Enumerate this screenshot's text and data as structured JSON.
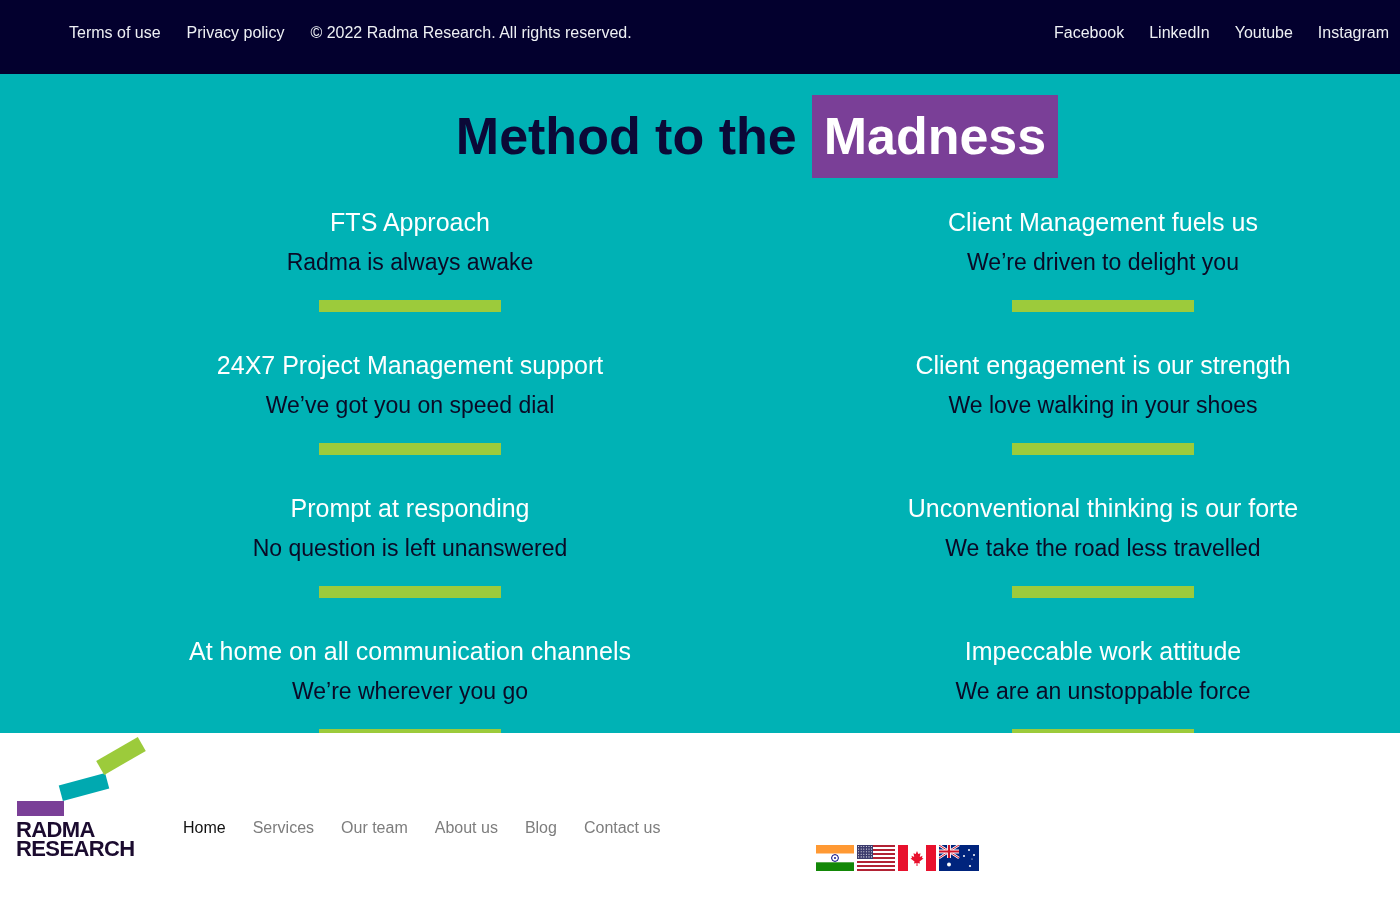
{
  "top_bar": {
    "legal_links": [
      "Terms of use",
      "Privacy policy"
    ],
    "copyright": "© 2022 Radma Research. All rights reserved.",
    "social_links": [
      "Facebook",
      "LinkedIn",
      "Youtube",
      "Instagram"
    ]
  },
  "method_section": {
    "title": "Method to the",
    "title_highlight": "Madness",
    "features": [
      {
        "heading": "FTS Approach",
        "tagline": "Radma is always awake"
      },
      {
        "heading": "Client Management fuels us",
        "tagline": "We’re driven to delight you"
      },
      {
        "heading": "24X7 Project Management support",
        "tagline": "We’ve got you on speed dial"
      },
      {
        "heading": "Client engagement is our strength",
        "tagline": "We love walking in your shoes"
      },
      {
        "heading": "Prompt at responding",
        "tagline": "No question is left unanswered"
      },
      {
        "heading": "Unconventional thinking is our forte",
        "tagline": "We take the road less travelled"
      },
      {
        "heading": "At home on all communication channels",
        "tagline": "We’re wherever you go"
      },
      {
        "heading": "Impeccable work attitude",
        "tagline": "We are an unstoppable force"
      }
    ]
  },
  "footer": {
    "logo_text": "RADMA RESEARCH",
    "nav": [
      {
        "label": "Home",
        "selected": true
      },
      {
        "label": "Services",
        "selected": false
      },
      {
        "label": "Our team",
        "selected": false
      },
      {
        "label": "About us",
        "selected": false
      },
      {
        "label": "Blog",
        "selected": false
      },
      {
        "label": "Contact us",
        "selected": false
      }
    ]
  }
}
